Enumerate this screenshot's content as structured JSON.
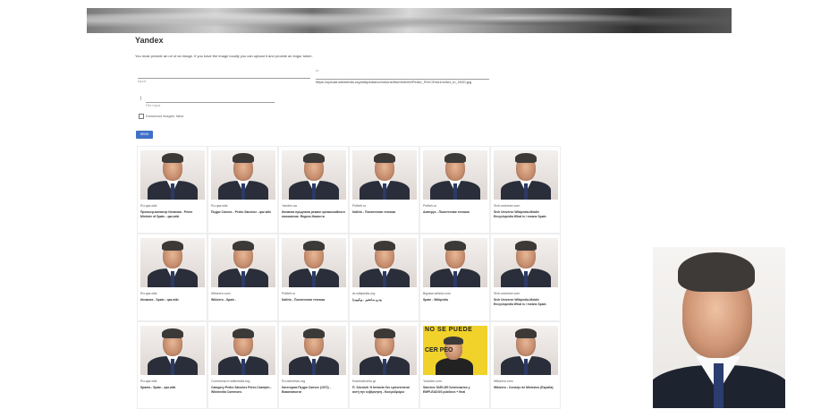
{
  "page": {
    "title": "Yandex",
    "intro": "You must provide an url of an image. If you have the image locally you can upload it and provide an imgur token."
  },
  "form": {
    "input_placeholder": "Input",
    "or_label": "or",
    "url_value": "https://upload.wikimedia.org/wikipedia/commons/thumb/e/eb/Pedro_S%C3%A1nchez_in_2020.jpg",
    "file_placeholder": "File input",
    "download_label": "Download images: false",
    "send_label": "SEND"
  },
  "results": [
    {
      "source": "Ru.qaz.wiki",
      "desc": "Премьер-министр Испании - Prime Minister of Spain - qaz.wiki",
      "poster": false
    },
    {
      "source": "Ru.qaz.wiki",
      "desc": "Педро Санчес - Pedro Sánchez - qaz.wiki",
      "poster": false
    },
    {
      "source": "Yandex.ua",
      "desc": "Испания продлила режим чрезвычайного положения: Яндекс.Новости",
      "poster": false
    },
    {
      "source": "Politeh.ru",
      "desc": "Кабеlo - Политеxная техника",
      "poster": false
    },
    {
      "source": "Politeh.ru",
      "desc": "Амперус - Политеxная техника",
      "poster": false
    },
    {
      "source": "Sivh.universe.com",
      "desc": "Sivh Universe Wikipedia-Mobile Encyclopedia What is / means Spain",
      "poster": false
    },
    {
      "source": "Ru.qaz.wiki",
      "desc": "Испания - Spain - qaz.wiki",
      "poster": false
    },
    {
      "source": "Wikizero.com",
      "desc": "Wikizero - Spain -",
      "poster": false
    },
    {
      "source": "Politeh.ru",
      "desc": "Кабеlo - Политеxная техника",
      "poster": false
    },
    {
      "source": "Ar.wikipedia.org",
      "desc": "بيدرو سانشيز - ويكيبيديا",
      "poster": false
    },
    {
      "source": "Bypass.wiland.com",
      "desc": "Spain - Wikipedia",
      "poster": false
    },
    {
      "source": "Sivh.universe.com",
      "desc": "Sivh Universe Wikipedia-Mobile Encyclopedia What is / means Spain",
      "poster": false
    },
    {
      "source": "Ru.qaz.wiki",
      "desc": "Spania - Spain - qaz.wiki",
      "poster": false
    },
    {
      "source": "Commons.m.wikimedia.org",
      "desc": "Category:Pedro Sánchez Pérez-Castejón - Wikimedia Commons",
      "poster": false
    },
    {
      "source": "Ru.wikinews.org",
      "desc": "Категория:Педро Санчес (1972) - Викиновости",
      "poster": false
    },
    {
      "source": "Kosmodromio.gr",
      "desc": "Π. Σάντσεθ: Η Ισπανία δεν εμπιστεύεται αυτή την κυβέρνηση - Κοσμοδρόμιο",
      "poster": false
    },
    {
      "source": "Youtube.com",
      "desc": "Sánchez SUELDE funcionarios y EMPLEADOS públicos + final",
      "poster": true,
      "poster_line1": "NO SE PUEDE",
      "poster_line2": "CER        PEO"
    },
    {
      "source": "Wikizero.com",
      "desc": "Wikizero - Consejo de Ministros (España)",
      "poster": false
    }
  ]
}
